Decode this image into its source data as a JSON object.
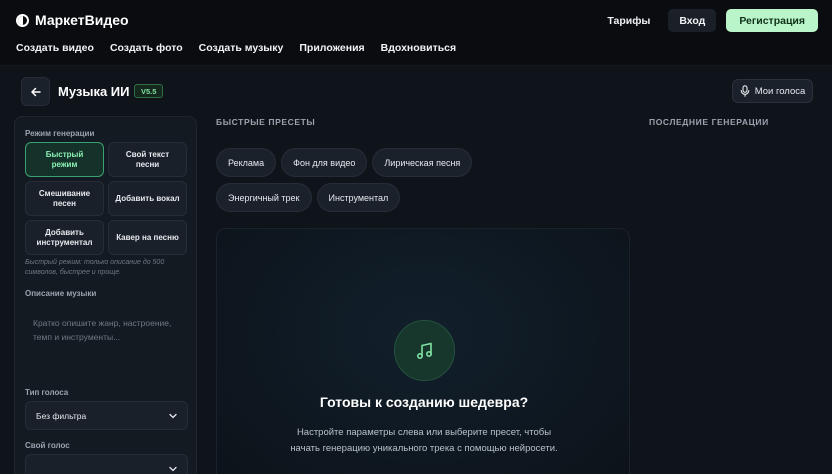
{
  "brand": {
    "name": "МаркетВидео"
  },
  "nav": [
    "Создать видео",
    "Создать фото",
    "Создать музыку",
    "Приложения",
    "Вдохновиться"
  ],
  "top_actions": {
    "pricing": "Тарифы",
    "login": "Вход",
    "register": "Регистрация"
  },
  "header": {
    "title": "Музыка ИИ",
    "version": "V5.5",
    "voices_button": "Мои голоса",
    "back_icon": "arrow-left-icon"
  },
  "left_panel": {
    "mode_label": "Режим генерации",
    "modes": [
      {
        "label": "Быстрый режим",
        "active": true
      },
      {
        "label": "Свой текст песни",
        "active": false
      },
      {
        "label": "Смешивание песен",
        "active": false
      },
      {
        "label": "Добавить вокал",
        "active": false
      },
      {
        "label": "Добавить инструментал",
        "active": false
      },
      {
        "label": "Кавер на песню",
        "active": false
      }
    ],
    "hint": "Быстрый режим: только описание до 500 символов, быстрее и проще.",
    "description_label": "Описание музыки",
    "description_placeholder": "Кратко опишите жанр, настроение, темп и инструменты...",
    "voice_type_label": "Тип голоса",
    "voice_type_value": "Без фильтра",
    "own_voice_label": "Свой голос",
    "own_voice_value": ""
  },
  "presets": {
    "title": "БЫСТРЫЕ ПРЕСЕТЫ",
    "items": [
      "Реклама",
      "Фон для видео",
      "Лирическая песня",
      "Энергичный трек",
      "Инструментал"
    ]
  },
  "recent": {
    "title": "ПОСЛЕДНИЕ ГЕНЕРАЦИИ"
  },
  "hero": {
    "icon": "music-note-icon",
    "title": "Готовы к созданию шедевра?",
    "text": "Настройте параметры слева или выберите пресет, чтобы начать генерацию уникального трека с помощью нейросети."
  },
  "colors": {
    "accent": "#b9f5c8",
    "active_mode": "#8af0b4",
    "background": "#0f141b"
  }
}
